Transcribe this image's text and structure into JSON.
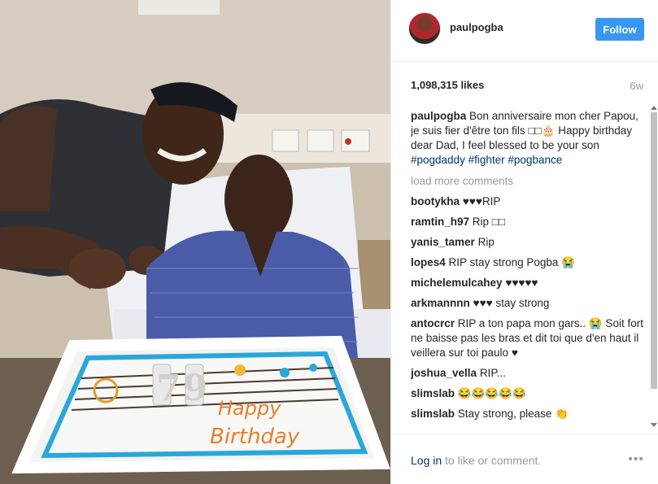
{
  "post": {
    "username": "paulpogba",
    "follow_label": "Follow",
    "likes": "1,098,315 likes",
    "age": "6w",
    "caption": {
      "username": "paulpogba",
      "text": "Bon anniversaire mon cher Papou, je suis fier d'être ton fils □□🎂 Happy birthday dear Dad, I feel blessed to be your son",
      "tags": [
        "#pogdaddy",
        "#fighter",
        "#pogbance"
      ]
    },
    "load_more": "load more comments",
    "comments": [
      {
        "user": "bootykha",
        "text": "♥♥♥RIP"
      },
      {
        "user": "ramtin_h97",
        "text": "Rip □□"
      },
      {
        "user": "yanis_tamer",
        "text": "Rip"
      },
      {
        "user": "lopes4",
        "text": "RIP stay strong Pogba 😭"
      },
      {
        "user": "michelemulcahey",
        "text": "♥♥♥♥♥"
      },
      {
        "user": "arkmannnn",
        "text": "♥♥♥ stay strong"
      },
      {
        "user": "antocrcr",
        "text": "RIP a ton papa mon gars.. 😭 Soit fort ne baisse pas les bras et dit toi que d'en haut il veillera sur toi paulo ♥"
      },
      {
        "user": "joshua_vella",
        "text": "RIP..."
      },
      {
        "user": "slimslab",
        "text": "😂😂😂😂😂"
      },
      {
        "user": "slimslab",
        "text": "Stay strong, please 👏"
      }
    ],
    "footer": {
      "login_link": "Log in",
      "login_rest": " to like or comment.",
      "more": "•••"
    }
  },
  "photo": {
    "cake_text_line1": "Happy",
    "cake_text_line2": "Birthday",
    "candle_text": "79"
  },
  "colors": {
    "follow_button": "#3897f0",
    "hashtag": "#003569",
    "muted": "#999999"
  }
}
